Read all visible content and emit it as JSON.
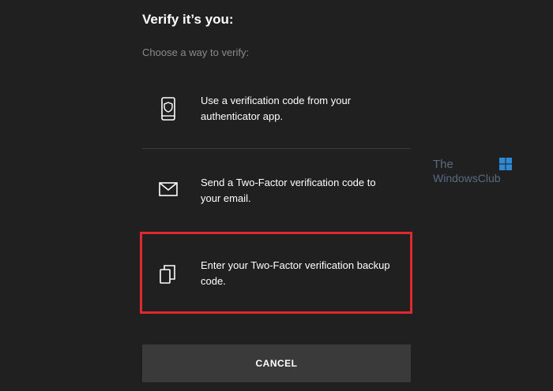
{
  "header": {
    "title": "Verify it’s you:",
    "subtitle": "Choose a way to verify:"
  },
  "options": [
    {
      "icon": "phone-shield-icon",
      "label": "Use a verification code from your authenticator app."
    },
    {
      "icon": "envelope-icon",
      "label": "Send a Two-Factor verification code to your email."
    },
    {
      "icon": "copy-pages-icon",
      "label": "Enter your Two-Factor verification backup code."
    }
  ],
  "actions": {
    "cancel_label": "CANCEL"
  },
  "watermark": {
    "line1": "The",
    "line2": "WindowsClub"
  },
  "colors": {
    "background": "#202020",
    "highlight": "#e0282f",
    "button": "#3a3a3a",
    "muted_text": "#8a8a8a"
  }
}
